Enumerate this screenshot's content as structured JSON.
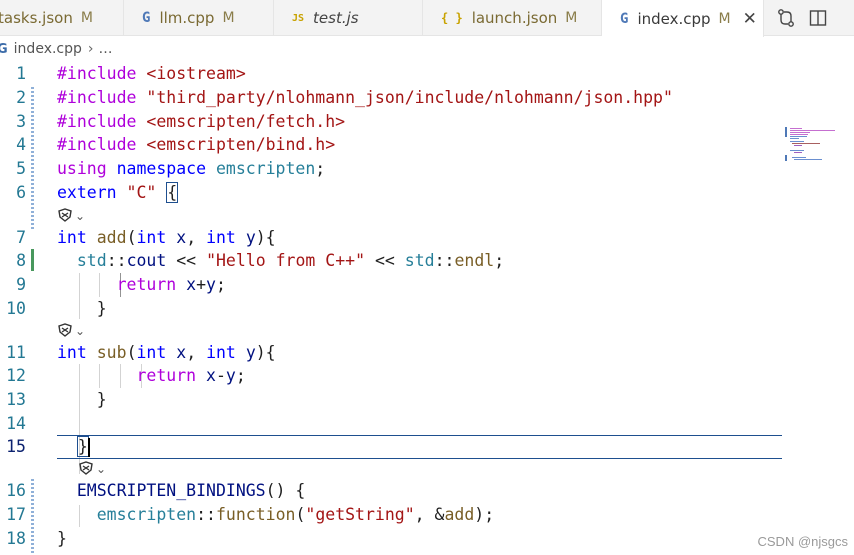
{
  "tabs": [
    {
      "name": "tasks.json",
      "status": "M",
      "icon": "json-icon",
      "icon_glyph": ""
    },
    {
      "name": "llm.cpp",
      "status": "M",
      "icon": "cpp-icon",
      "icon_glyph": "G"
    },
    {
      "name": "test.js",
      "status": "",
      "icon": "js-icon",
      "icon_glyph": "JS"
    },
    {
      "name": "launch.json",
      "status": "M",
      "icon": "json-icon",
      "icon_glyph": "{ }"
    },
    {
      "name": "index.cpp",
      "status": "M",
      "icon": "cpp-icon",
      "icon_glyph": "G",
      "close": "✕"
    }
  ],
  "breadcrumb": {
    "file": "index.cpp",
    "sep": "›",
    "more": "…",
    "icon_glyph": "G"
  },
  "editor": {
    "current_line": 15,
    "lines": [
      {
        "n": "1",
        "text": "#include <iostream>"
      },
      {
        "n": "2",
        "text": "#include \"third_party/nlohmann_json/include/nlohmann/json.hpp\""
      },
      {
        "n": "3",
        "text": "#include <emscripten/fetch.h>"
      },
      {
        "n": "4",
        "text": "#include <emscripten/bind.h>"
      },
      {
        "n": "5",
        "text": "using namespace emscripten;"
      },
      {
        "n": "6",
        "text": "extern \"C\" {"
      },
      {
        "n": "7",
        "text": "int add(int x, int y){"
      },
      {
        "n": "8",
        "text": "  std::cout << \"Hello from C++\" << std::endl;"
      },
      {
        "n": "9",
        "text": "      return x+y;"
      },
      {
        "n": "10",
        "text": "  }"
      },
      {
        "n": "11",
        "text": "int sub(int x, int y){"
      },
      {
        "n": "12",
        "text": "        return x-y;"
      },
      {
        "n": "13",
        "text": "  }"
      },
      {
        "n": "14",
        "text": ""
      },
      {
        "n": "15",
        "text": "  }"
      },
      {
        "n": "16",
        "text": "  EMSCRIPTEN_BINDINGS() {"
      },
      {
        "n": "17",
        "text": "    emscripten::function(\"getString\", &add);"
      },
      {
        "n": "18",
        "text": "}"
      }
    ],
    "codelens_glyph": "⌄"
  },
  "watermark": "CSDN @njsgcs",
  "colors": {
    "keyword": "#0000ff",
    "include": "#af00db",
    "string": "#a31515",
    "namespace": "#267f99",
    "function": "#795e26",
    "variable": "#001080",
    "line_number": "#237893",
    "git_added": "#48985d",
    "git_modified": "#8fb0d8"
  }
}
